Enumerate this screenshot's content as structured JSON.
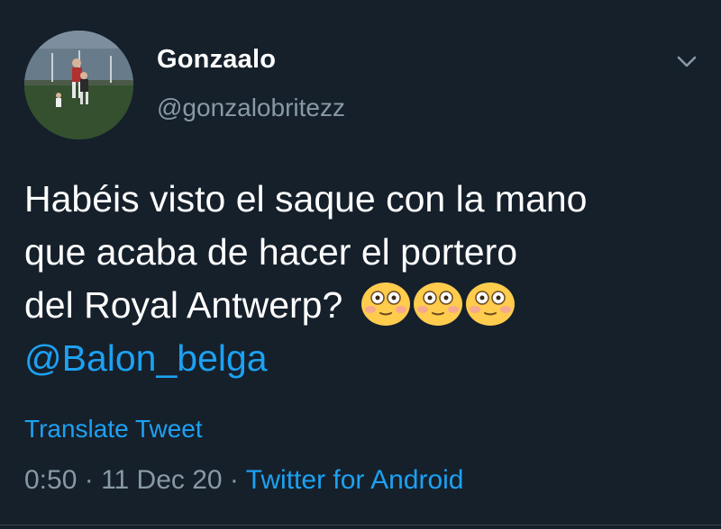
{
  "user": {
    "display_name": "Gonzaalo",
    "handle": "@gonzalobritezz"
  },
  "tweet": {
    "line1": "Habéis visto el saque con la mano",
    "line2": "que acaba de hacer el portero",
    "line3": "del Royal Antwerp? ",
    "mention": "@Balon_belga",
    "emojis": [
      "flushed-face-icon",
      "flushed-face-icon",
      "flushed-face-icon"
    ]
  },
  "actions": {
    "translate_label": "Translate Tweet",
    "menu_icon": "chevron-down-icon"
  },
  "meta": {
    "time": "0:50",
    "sep1": " · ",
    "date": "11 Dec 20",
    "sep2": " · ",
    "source": "Twitter for Android"
  },
  "colors": {
    "background": "#15202b",
    "primary_text": "#ffffff",
    "secondary_text": "#8899a6",
    "link": "#1da1f2",
    "emoji_yellow": "#ffcc4d"
  }
}
